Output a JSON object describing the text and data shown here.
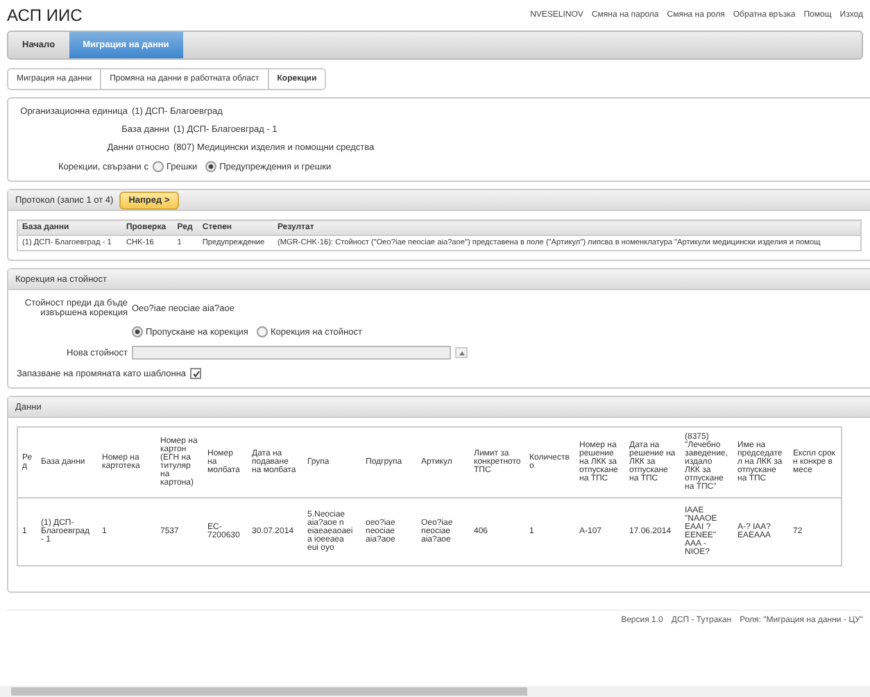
{
  "app_title": "АСП ИИС",
  "top_links": [
    "NVESELINOV",
    "Смяна на парола",
    "Смяна на роля",
    "Обратна връзка",
    "Помощ",
    "Изход"
  ],
  "nav_tabs": [
    {
      "label": "Начало",
      "selected": false
    },
    {
      "label": "Миграция на данни",
      "selected": true
    }
  ],
  "breadcrumbs": [
    {
      "label": "Миграция на данни",
      "selected": false
    },
    {
      "label": "Промяна на данни в работната област",
      "selected": false
    },
    {
      "label": "Корекции",
      "selected": true
    }
  ],
  "info": {
    "fields": [
      {
        "label": "Организационна единица",
        "value": "(1) ДСП- Благоевград"
      },
      {
        "label": "База данни",
        "value": "(1) ДСП- Благоевград - 1"
      },
      {
        "label": "Данни относно",
        "value": "(807) Медицински изделия и помощни средства"
      }
    ],
    "filter_label": "Корекции, свързани с",
    "filter_options": [
      {
        "label": "Грешки",
        "selected": false
      },
      {
        "label": "Предупреждения и грешки",
        "selected": true
      }
    ]
  },
  "protocol": {
    "title": "Протокол (запис 1 от 4)",
    "next_button": "Напред >",
    "columns": [
      "База данни",
      "Проверка",
      "Ред",
      "Степен",
      "Резултат"
    ],
    "rows": [
      [
        "(1) ДСП- Благоевград - 1",
        "CHK-16",
        "1",
        "Предупреждение",
        "(MGR-CHK-16): Стойност (\"Оео?іае пеосіае аіа?аое\") представена в поле (\"Артикул\") липсва в номенклатура \"Артикули медицински изделия и помощ"
      ]
    ]
  },
  "correction": {
    "title": "Корекция на стойност",
    "before_label": "Стойност преди да бъде извършена корекция",
    "before_value": "Оео?іае пеосіае аіа?аое",
    "options": [
      {
        "label": "Пропускане на корекция",
        "selected": true
      },
      {
        "label": "Корекция на стойност",
        "selected": false
      }
    ],
    "new_value_label": "Нова стойност",
    "new_value_disabled": true,
    "save_template_label": "Запазване на промяната като шаблонна",
    "save_template_checked": true
  },
  "data": {
    "title": "Данни",
    "columns": [
      "Ред",
      "База данни",
      "Номер на картотека",
      "Номер на картон (ЕГН на титуляр на картона)",
      "Номер на молбата",
      "Дата на подаване на молбата",
      "Група",
      "Подгрупа",
      "Артикул",
      "Лимит за конкретното ТПС",
      "Количество",
      "Номер на решение на ЛКК за отпускане на ТПС",
      "Дата на решение на ЛКК за отпускане на ТПС",
      "(8375) \"Лечебно заведение, издало ЛКК за отпускане на ТПС\"",
      "Име на председател на ЛКК за отпускане на ТПС",
      "Експл срок н конкре в месе"
    ],
    "rows": [
      [
        "1",
        "(1) ДСП- Благоевград - 1",
        "1",
        "7537",
        "ЕС- 7200630",
        "30.07.2014",
        "5.Neociae aia?aoe n eiaeaeaoaeia ioeeaea eui oyo",
        "oeo?iae neociae aia?aoe",
        "Oeo?iae neociae aia?aoe",
        "406",
        "1",
        "А-107",
        "17.06.2014",
        "IAAE \"NAAOE EAAI ? EENEE\" AAA - NIOE?",
        "A-? IAA? EAEAAA",
        "72"
      ]
    ]
  },
  "footer": [
    "Версия 1.0",
    "ДСП - Тутракан",
    "Роля: \"Миграция на данни - ЦУ\""
  ]
}
